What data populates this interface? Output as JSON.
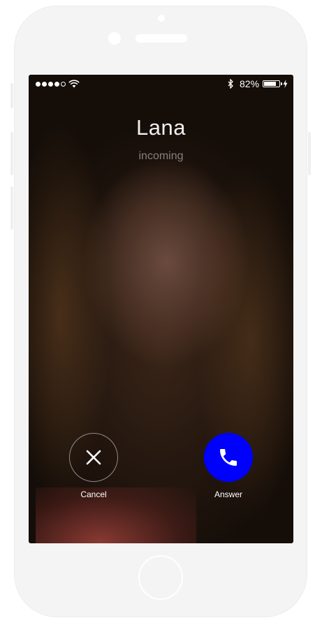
{
  "status_bar": {
    "signal_dots_filled": 4,
    "signal_dots_total": 5,
    "battery_percent": "82%",
    "battery_level": 0.82,
    "icons": [
      "wifi-icon",
      "bluetooth-icon",
      "battery-icon",
      "charging-bolt-icon"
    ]
  },
  "call": {
    "caller_name": "Lana",
    "status": "incoming"
  },
  "actions": {
    "cancel_label": "Cancel",
    "cancel_icon": "close-icon",
    "answer_label": "Answer",
    "answer_icon": "phone-icon"
  },
  "colors": {
    "answer_button": "#0000ff",
    "device_frame": "#f4f4f4"
  }
}
